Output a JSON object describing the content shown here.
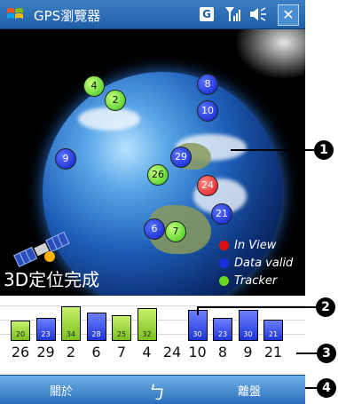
{
  "titlebar": {
    "title": "GPS瀏覽器",
    "gps_indicator": "G",
    "close_label": "✕",
    "icons": [
      "windows-start-icon",
      "gps-status-icon",
      "signal-icon",
      "volume-icon",
      "close-icon"
    ]
  },
  "sky": {
    "status": "3D定位完成",
    "satellites": [
      {
        "prn": "4",
        "state": "tracker"
      },
      {
        "prn": "2",
        "state": "tracker"
      },
      {
        "prn": "8",
        "state": "data_valid"
      },
      {
        "prn": "10",
        "state": "data_valid"
      },
      {
        "prn": "9",
        "state": "data_valid"
      },
      {
        "prn": "29",
        "state": "data_valid"
      },
      {
        "prn": "26",
        "state": "tracker"
      },
      {
        "prn": "24",
        "state": "in_view"
      },
      {
        "prn": "21",
        "state": "data_valid"
      },
      {
        "prn": "6",
        "state": "data_valid"
      },
      {
        "prn": "7",
        "state": "tracker"
      }
    ],
    "legend": [
      {
        "label": "In View",
        "color": "#e01010"
      },
      {
        "label": "Data valid",
        "color": "#1a2ee0"
      },
      {
        "label": "Tracker",
        "color": "#6ad81e"
      }
    ]
  },
  "signal": {
    "bars": [
      {
        "prn": "26",
        "value": "20",
        "state": "tracker"
      },
      {
        "prn": "29",
        "value": "23",
        "state": "data_valid"
      },
      {
        "prn": "2",
        "value": "34",
        "state": "tracker"
      },
      {
        "prn": "6",
        "value": "28",
        "state": "data_valid"
      },
      {
        "prn": "7",
        "value": "25",
        "state": "tracker"
      },
      {
        "prn": "4",
        "value": "32",
        "state": "tracker"
      },
      {
        "prn": "24",
        "value": "",
        "state": "none"
      },
      {
        "prn": "10",
        "value": "30",
        "state": "data_valid"
      },
      {
        "prn": "8",
        "value": "23",
        "state": "data_valid"
      },
      {
        "prn": "9",
        "value": "30",
        "state": "data_valid"
      },
      {
        "prn": "21",
        "value": "21",
        "state": "data_valid"
      }
    ]
  },
  "toolbar": {
    "left_label": "關於",
    "center_icon": "back-arrow-icon",
    "right_label": "離盤"
  },
  "callouts": [
    "1",
    "2",
    "3",
    "4"
  ]
}
